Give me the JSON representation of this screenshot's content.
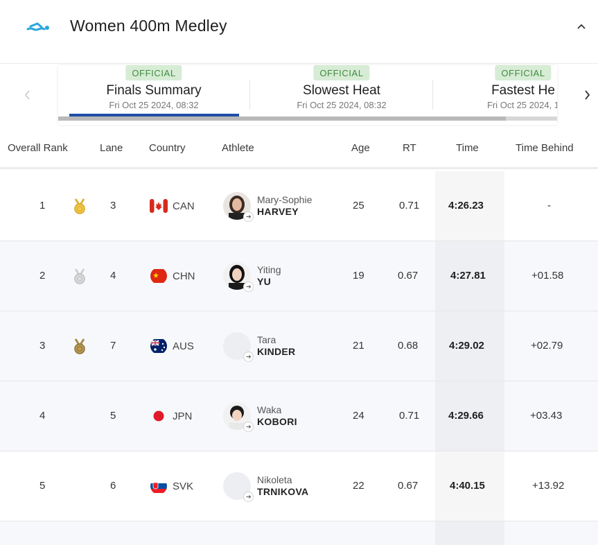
{
  "header": {
    "title": "Women 400m Medley",
    "collapse_icon": "chevron-up-icon"
  },
  "tabs": [
    {
      "badge": "OFFICIAL",
      "name": "Finals Summary",
      "date": "Fri Oct 25 2024, 08:32",
      "active": true
    },
    {
      "badge": "OFFICIAL",
      "name": "Slowest Heat",
      "date": "Fri Oct 25 2024, 08:32",
      "active": false
    },
    {
      "badge": "OFFICIAL",
      "name": "Fastest He",
      "date": "Fri Oct 25 2024, 1",
      "active": false
    }
  ],
  "table": {
    "headers": {
      "rank": "Overall Rank",
      "lane": "Lane",
      "country": "Country",
      "athlete": "Athlete",
      "age": "Age",
      "rt": "RT",
      "time": "Time",
      "behind": "Time Behind"
    },
    "rows": [
      {
        "rank": "1",
        "medal": "gold",
        "lane": "3",
        "country": "CAN",
        "first": "Mary-Sophie",
        "last": "HARVEY",
        "age": "25",
        "rt": "0.71",
        "time": "4:26.23",
        "behind": "-"
      },
      {
        "rank": "2",
        "medal": "silver",
        "lane": "4",
        "country": "CHN",
        "first": "Yiting",
        "last": "YU",
        "age": "19",
        "rt": "0.67",
        "time": "4:27.81",
        "behind": "+01.58"
      },
      {
        "rank": "3",
        "medal": "bronze",
        "lane": "7",
        "country": "AUS",
        "first": "Tara",
        "last": "KINDER",
        "age": "21",
        "rt": "0.68",
        "time": "4:29.02",
        "behind": "+02.79"
      },
      {
        "rank": "4",
        "medal": "",
        "lane": "5",
        "country": "JPN",
        "first": "Waka",
        "last": "KOBORI",
        "age": "24",
        "rt": "0.71",
        "time": "4:29.66",
        "behind": "+03.43"
      },
      {
        "rank": "5",
        "medal": "",
        "lane": "6",
        "country": "SVK",
        "first": "Nikoleta",
        "last": "TRNIKOVA",
        "age": "22",
        "rt": "0.67",
        "time": "4:40.15",
        "behind": "+13.92"
      }
    ]
  },
  "colors": {
    "accent": "#1f4fa6",
    "official_bg": "#d7ecd5",
    "official_text": "#3f8a3f",
    "gold": "#e2b230",
    "silver": "#c9c9c9",
    "bronze": "#a88a4a"
  }
}
